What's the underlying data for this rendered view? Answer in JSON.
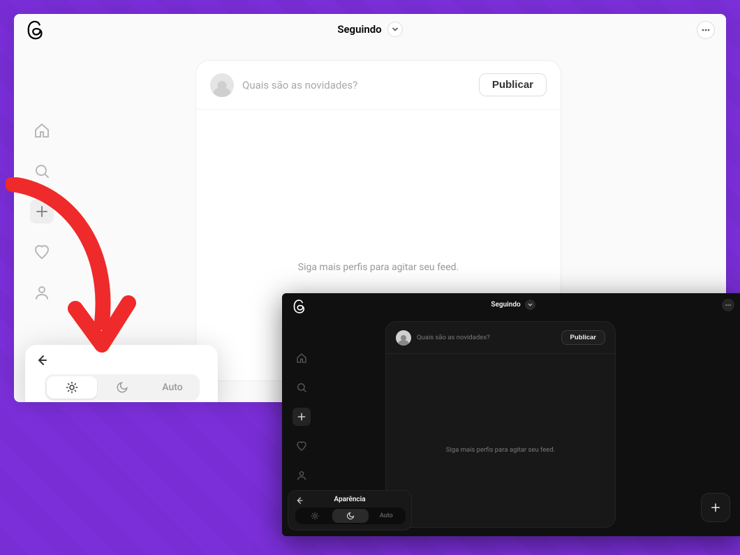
{
  "light": {
    "header": {
      "tab_label": "Seguindo"
    },
    "composer": {
      "placeholder": "Quais são as novidades?",
      "publish_label": "Publicar"
    },
    "feed": {
      "empty_text": "Siga mais perfis para agitar seu feed."
    },
    "appearance": {
      "auto_label": "Auto"
    }
  },
  "dark": {
    "header": {
      "tab_label": "Seguindo"
    },
    "composer": {
      "placeholder": "Quais são as novidades?",
      "publish_label": "Publicar"
    },
    "feed": {
      "empty_text": "Siga mais perfis para agitar seu feed."
    },
    "appearance": {
      "title": "Aparência",
      "auto_label": "Auto"
    }
  }
}
